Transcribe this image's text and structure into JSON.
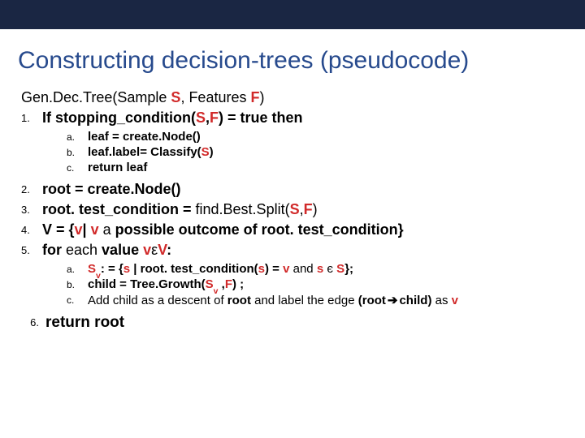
{
  "title": "Constructing decision-trees (pseudocode)",
  "sig_pre": "Gen.Dec.Tree",
  "sig_mid1": "(Sample ",
  "sig_s": "S",
  "sig_mid2": ", Features ",
  "sig_f": "F",
  "sig_end": ")",
  "n1": "1.",
  "l1_a": "If stopping_condition(",
  "l1_b": "S",
  "l1_c": ",",
  "l1_d": "F",
  "l1_e": ") = true then",
  "na": "a.",
  "nb": "b.",
  "nc": "c.",
  "a1": "leaf = create.Node()",
  "b1_a": "leaf.label= Classify(",
  "b1_b": "S",
  "b1_c": ")",
  "c1": "return leaf",
  "n2": "2.",
  "l2": "root = create.Node()",
  "n3": "3.",
  "l3_a": "root. test_condition = ",
  "l3_b": "find.Best.Split(",
  "l3_c": "S",
  "l3_d": ",",
  "l3_e": "F",
  "l3_f": ")",
  "n4": "4.",
  "l4_a": "V = {",
  "l4_b": "v",
  "l4_c": "| ",
  "l4_d": "v",
  "l4_e": " a ",
  "l4_f": "possible outcome of root. test_condition}",
  "n5": "5.",
  "l5_a": "for ",
  "l5_b": "each ",
  "l5_c": "value ",
  "l5_d": "v",
  "l5_e": "ε",
  "l5_f": "V",
  "l5_g": ":",
  "a5_a": "S",
  "a5_b": "v",
  "a5_c": ": = {",
  "a5_d": "s",
  "a5_e": " | root. test_condition(",
  "a5_f": "s",
  "a5_g": ") = ",
  "a5_h": "v",
  "a5_i": " and ",
  "a5_j": "s",
  "a5_k": " є ",
  "a5_l": "S",
  "a5_m": "};",
  "b5_a": "child = Tree.Growth(",
  "b5_b": "S",
  "b5_c": "v",
  "b5_d": " ,",
  "b5_e": "F",
  "b5_f": ") ;",
  "c5_a": "Add child ",
  "c5_b": "as a descent of ",
  "c5_c": "root ",
  "c5_d": "and label the edge ",
  "c5_e": "(root",
  "c5_f": "child)",
  "c5_g": " as ",
  "c5_h": "v",
  "n6": "6.",
  "l6": "return root",
  "arrow": "➔"
}
